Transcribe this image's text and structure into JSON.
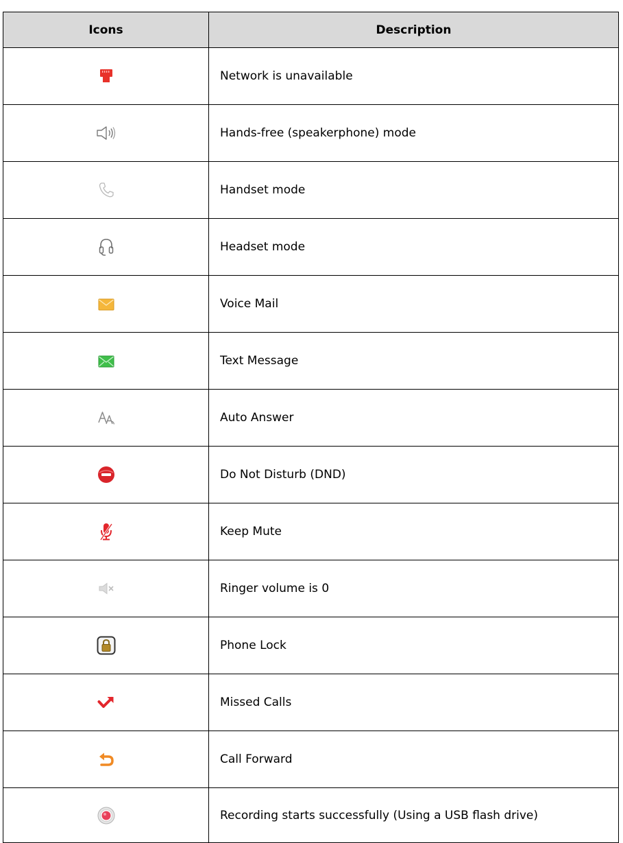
{
  "table": {
    "headers": {
      "icons": "Icons",
      "description": "Description"
    },
    "rows": [
      {
        "icon": "network-unavailable-icon",
        "description": "Network is unavailable"
      },
      {
        "icon": "speakerphone-icon",
        "description": "Hands-free (speakerphone) mode"
      },
      {
        "icon": "handset-icon",
        "description": "Handset mode"
      },
      {
        "icon": "headset-icon",
        "description": "Headset mode"
      },
      {
        "icon": "voice-mail-icon",
        "description": "Voice Mail"
      },
      {
        "icon": "text-message-icon",
        "description": "Text Message"
      },
      {
        "icon": "auto-answer-icon",
        "description": "Auto Answer"
      },
      {
        "icon": "do-not-disturb-icon",
        "description": "Do Not Disturb (DND)"
      },
      {
        "icon": "keep-mute-icon",
        "description": "Keep Mute"
      },
      {
        "icon": "ringer-volume-zero-icon",
        "description": "Ringer volume is 0"
      },
      {
        "icon": "phone-lock-icon",
        "description": "Phone Lock"
      },
      {
        "icon": "missed-calls-icon",
        "description": "Missed Calls"
      },
      {
        "icon": "call-forward-icon",
        "description": "Call Forward"
      },
      {
        "icon": "recording-icon",
        "description": "Recording starts successfully (Using a USB flash drive)"
      }
    ]
  },
  "colors": {
    "header_background": "#d9d9d9",
    "border": "#000000",
    "network_red": "#e8322a",
    "dnd_red": "#d9242a",
    "voicemail_orange": "#f5b73b",
    "message_green": "#3fbf4a",
    "forward_orange": "#f08a24"
  }
}
